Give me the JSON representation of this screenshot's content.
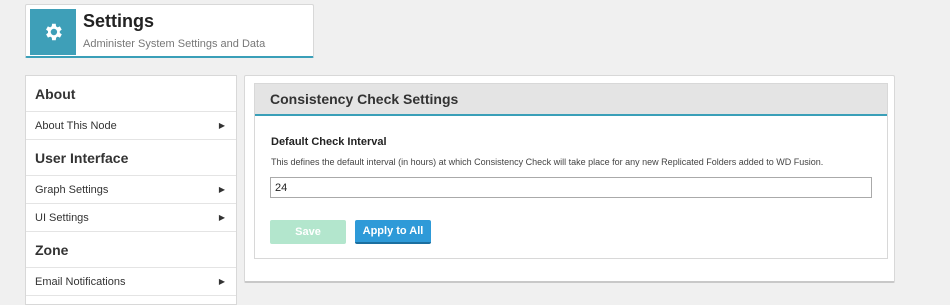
{
  "header": {
    "title": "Settings",
    "subtitle": "Administer System Settings and Data",
    "icon": "gear-icon",
    "accent": "#3e9fb8"
  },
  "sidebar": {
    "sections": [
      {
        "label": "About",
        "items": [
          {
            "label": "About This Node"
          }
        ]
      },
      {
        "label": "User Interface",
        "items": [
          {
            "label": "Graph Settings"
          },
          {
            "label": "UI Settings"
          }
        ]
      },
      {
        "label": "Zone",
        "items": [
          {
            "label": "Email Notifications"
          }
        ]
      }
    ]
  },
  "main": {
    "panel_title": "Consistency Check Settings",
    "field_label": "Default Check Interval",
    "field_help": "This defines the default interval (in hours) at which Consistency Check will take place for any new Replicated Folders added to WD Fusion.",
    "field_value": "24",
    "save_label": "Save",
    "apply_label": "Apply to All"
  }
}
